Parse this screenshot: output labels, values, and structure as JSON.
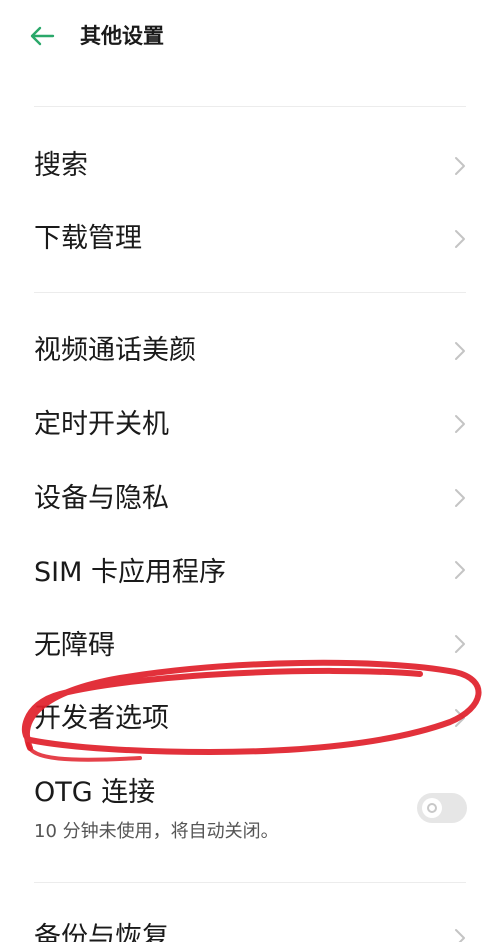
{
  "header": {
    "title": "其他设置",
    "back_icon": "arrow-left-icon",
    "accent_color": "#2aa86a"
  },
  "list": {
    "search": "搜索",
    "downloads": "下载管理",
    "video_beauty": "视频通话美颜",
    "scheduled_power": "定时开关机",
    "device_privacy": "设备与隐私",
    "sim_toolkit": "SIM 卡应用程序",
    "accessibility": "无障碍",
    "developer_options": "开发者选项",
    "otg": "OTG 连接",
    "otg_sub": "10 分钟未使用，将自动关闭。",
    "otg_enabled": false,
    "backup_restore": "备份与恢复"
  },
  "annotation": {
    "color": "#e0202a",
    "target": "developer_options"
  }
}
